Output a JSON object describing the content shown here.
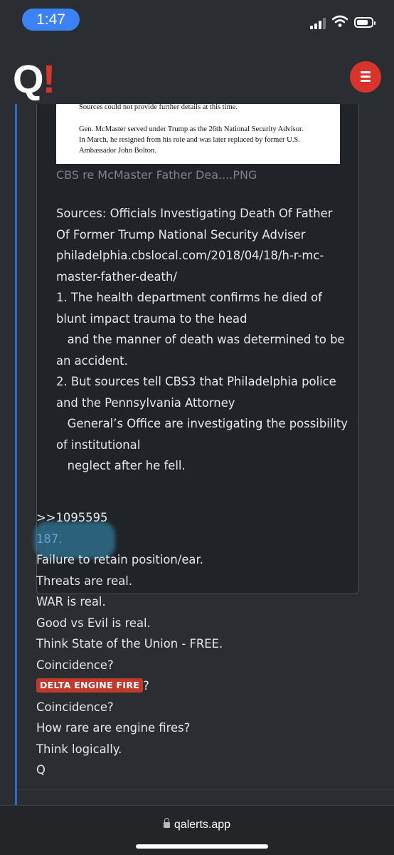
{
  "status_bar": {
    "time": "1:47"
  },
  "app": {
    "logo_q": "Q",
    "logo_mark": "!",
    "menu_icon": "hamburger-icon"
  },
  "card": {
    "clipping_lines": [
      "Sources could not provide further details at this time.",
      "Gen. McMaster served under Trump as the 26th National Security Advisor.",
      "In March, he resigned from his role and was later replaced by former U.S.",
      "Ambassador John Bolton."
    ],
    "filename": "CBS re McMaster Father Dea....PNG",
    "text": "Sources: Officials Investigating Death Of Father\nOf Former Trump National Security Adviser\nphiladelphia.cbslocal.com/2018/04/18/h-r-mc-\nmaster-father-death/\n1. The health department confirms he died of\nblunt impact trauma to the head\n   and the manner of death was determined to be\nan accident.\n2. But sources tell CBS3 that Philadelphia police\nand the Pennsylvania Attorney\n   General’s Office are investigating the possibility\nof institutional\n   neglect after he fell."
  },
  "post": {
    "reply_ref": ">>1095595",
    "lines": [
      "187.",
      "Failure to retain position/ear.",
      "Threats are real.",
      "WAR is real.",
      "Good vs Evil is real.",
      "Think State of the Union - FREE.",
      "Coincidence?"
    ],
    "tag": "DELTA ENGINE FIRE",
    "tag_suffix": "?",
    "lines_after": [
      "Coincidence?",
      "How rare are engine fires?",
      "Think logically.",
      "Q"
    ]
  },
  "browser": {
    "url": "qalerts.app"
  },
  "colors": {
    "accent_red": "#d9342b",
    "left_bar": "#3366cc",
    "link_blue": "#6d9fd0"
  }
}
